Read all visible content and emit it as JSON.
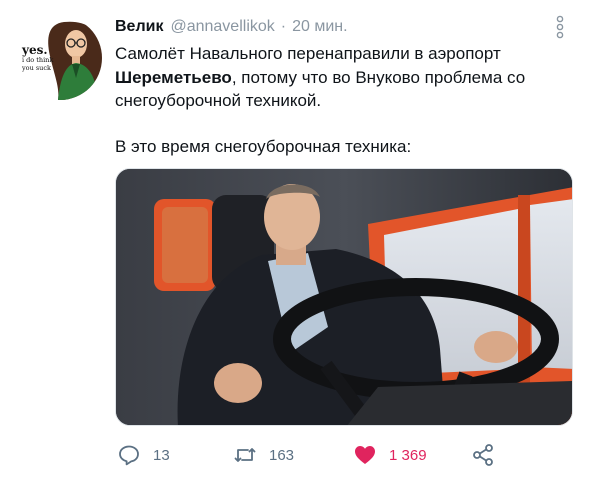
{
  "tweet": {
    "author": {
      "display_name": "Велик",
      "handle": "@annavellikok",
      "separator": "·",
      "time": "20 мин.",
      "avatar_icon": "cartoon-girl-avatar",
      "avatar_text_big": "yes.",
      "avatar_text_small_1": "i do think",
      "avatar_text_small_2": "you suck"
    },
    "text": {
      "line1_start": "Самолёт Навального перенаправили в аэропорт ",
      "line1_bold": "Шереметьево",
      "line1_end": ", потому что во Внуково проблема со снегоуборочной техникой.",
      "paragraph2": "В это время снегоуборочная техника:"
    },
    "media": {
      "icon": "photo-man-driving-truck"
    },
    "actions": {
      "reply_icon": "reply-icon",
      "reply_count": "13",
      "retweet_icon": "retweet-icon",
      "retweet_count": "163",
      "like_icon": "heart-icon",
      "like_count": "1 369",
      "share_icon": "share-icon"
    },
    "more_icon": "more-vertical-icon",
    "colors": {
      "muted": "#8a96a1",
      "like": "#e0245e",
      "text": "#0f1419"
    }
  }
}
